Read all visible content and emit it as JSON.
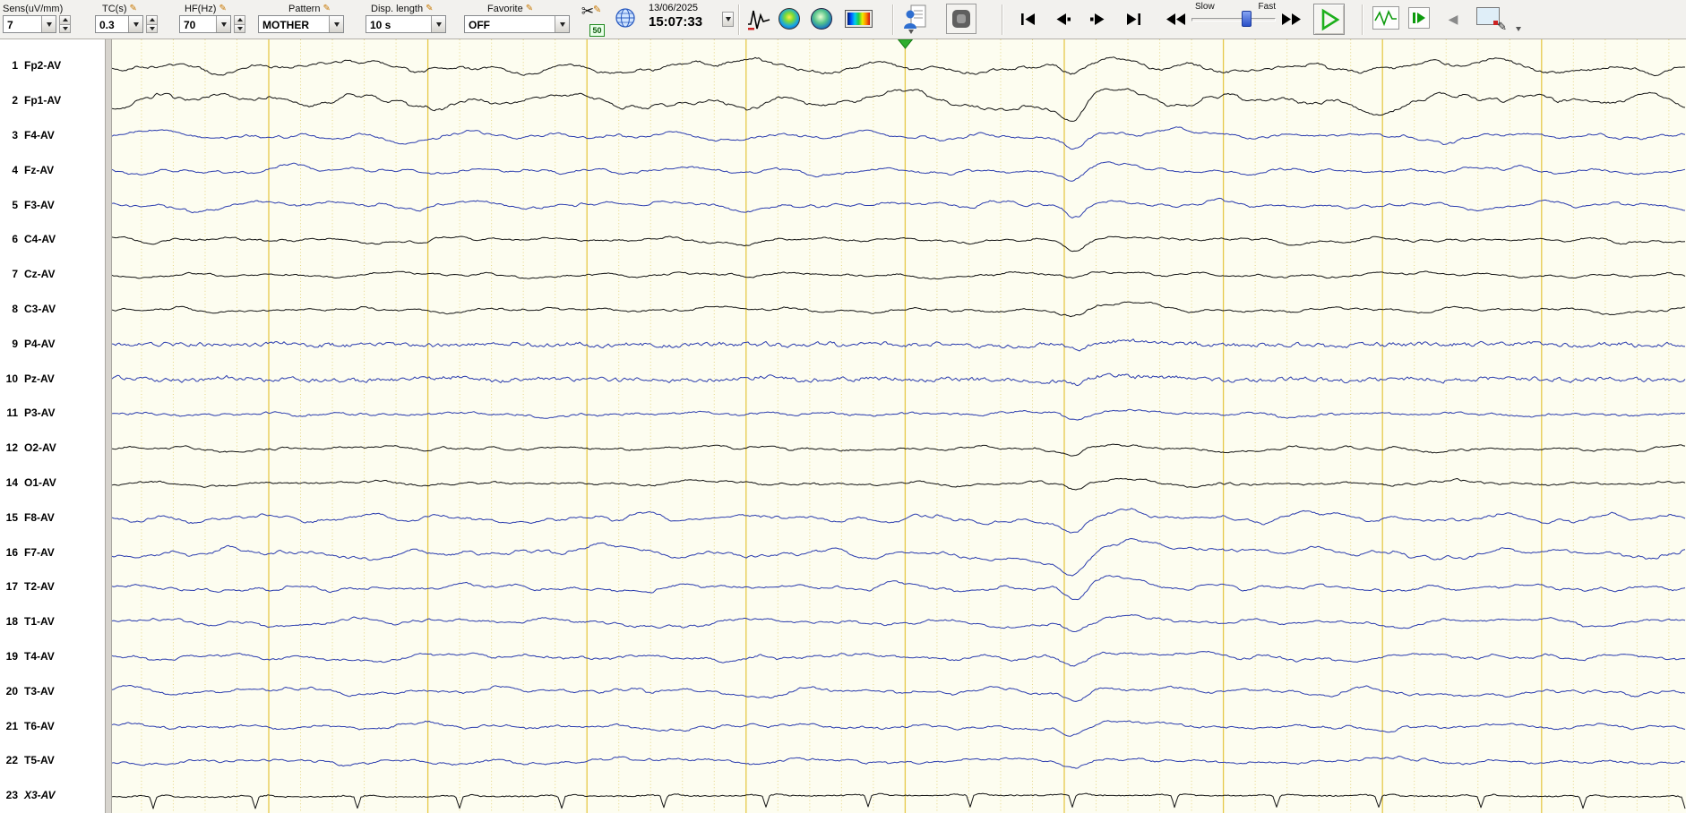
{
  "toolbar": {
    "sens": {
      "label": "Sens(uV/mm)",
      "value": "7"
    },
    "tc": {
      "label": "TC(s)",
      "value": "0.3"
    },
    "hf": {
      "label": "HF(Hz)",
      "value": "70"
    },
    "pattern": {
      "label": "Pattern",
      "value": "MOTHER"
    },
    "disp_length": {
      "label": "Disp. length",
      "value": "10 s"
    },
    "favorite": {
      "label": "Favorite",
      "value": "OFF"
    },
    "notch_badge": "50",
    "datetime": {
      "date": "13/06/2025",
      "time": "15:07:33"
    },
    "speed": {
      "slow": "Slow",
      "fast": "Fast"
    }
  },
  "icons": {
    "pencil": "✎",
    "scissors": "✂",
    "back_arrow_gray": "◀"
  },
  "colors": {
    "bg": "#fdfdf0",
    "trace_black": "#141414",
    "trace_blue": "#2b3cae",
    "grid_major": "#e6c94a",
    "grid_minor": "#e5d584",
    "marker_green": "#2eae2e"
  },
  "channels": [
    {
      "num": "1",
      "label": "Fp2-AV",
      "color": "black",
      "amp": 8.5,
      "fuzz": 1.2,
      "ev": 12,
      "slow": 1.5
    },
    {
      "num": "2",
      "label": "Fp1-AV",
      "color": "black",
      "amp": 9.5,
      "fuzz": 1.2,
      "ev": 20,
      "slow": 1.6
    },
    {
      "num": "3",
      "label": "F4-AV",
      "color": "blue",
      "amp": 7,
      "fuzz": 0.9,
      "ev": 15,
      "slow": 1.2
    },
    {
      "num": "4",
      "label": "Fz-AV",
      "color": "blue",
      "amp": 7,
      "fuzz": 0.9,
      "ev": 13,
      "slow": 1.1
    },
    {
      "num": "5",
      "label": "F3-AV",
      "color": "blue",
      "amp": 7.5,
      "fuzz": 0.9,
      "ev": 16,
      "slow": 1.2
    },
    {
      "num": "6",
      "label": "C4-AV",
      "color": "black",
      "amp": 5,
      "fuzz": 0.8,
      "ev": 9,
      "slow": 1
    },
    {
      "num": "7",
      "label": "Cz-AV",
      "color": "black",
      "amp": 4.5,
      "fuzz": 0.8,
      "ev": 7,
      "slow": 1
    },
    {
      "num": "8",
      "label": "C3-AV",
      "color": "black",
      "amp": 5.5,
      "fuzz": 0.8,
      "ev": 9,
      "slow": 1
    },
    {
      "num": "9",
      "label": "P4-AV",
      "color": "blue",
      "amp": 3.2,
      "fuzz": 2.2,
      "ev": 6,
      "slow": 0.8
    },
    {
      "num": "10",
      "label": "Pz-AV",
      "color": "blue",
      "amp": 3.2,
      "fuzz": 2.2,
      "ev": 8,
      "slow": 0.8
    },
    {
      "num": "11",
      "label": "P3-AV",
      "color": "blue",
      "amp": 4,
      "fuzz": 1,
      "ev": 8,
      "slow": 0.9
    },
    {
      "num": "12",
      "label": "O2-AV",
      "color": "black",
      "amp": 4.5,
      "fuzz": 0.9,
      "ev": 8,
      "slow": 1
    },
    {
      "num": "14",
      "label": "O1-AV",
      "color": "black",
      "amp": 4,
      "fuzz": 0.9,
      "ev": 7,
      "slow": 1
    },
    {
      "num": "15",
      "label": "F8-AV",
      "color": "blue",
      "amp": 7.5,
      "fuzz": 1,
      "ev": 17,
      "slow": 1.3
    },
    {
      "num": "16",
      "label": "F7-AV",
      "color": "blue",
      "amp": 8.5,
      "fuzz": 1,
      "ev": 24,
      "slow": 1.4
    },
    {
      "num": "17",
      "label": "T2-AV",
      "color": "blue",
      "amp": 6.5,
      "fuzz": 1,
      "ev": 15,
      "slow": 1.1
    },
    {
      "num": "18",
      "label": "T1-AV",
      "color": "blue",
      "amp": 6.5,
      "fuzz": 1,
      "ev": 13,
      "slow": 1.1
    },
    {
      "num": "19",
      "label": "T4-AV",
      "color": "blue",
      "amp": 6.5,
      "fuzz": 1,
      "ev": 11,
      "slow": 1.1
    },
    {
      "num": "20",
      "label": "T3-AV",
      "color": "blue",
      "amp": 6.5,
      "fuzz": 1,
      "ev": 13,
      "slow": 1.1
    },
    {
      "num": "21",
      "label": "T6-AV",
      "color": "blue",
      "amp": 5.5,
      "fuzz": 1,
      "ev": 9,
      "slow": 1
    },
    {
      "num": "22",
      "label": "T5-AV",
      "color": "blue",
      "amp": 5.5,
      "fuzz": 1,
      "ev": 8,
      "slow": 1
    },
    {
      "num": "23",
      "label": "X3-AV",
      "color": "black",
      "type": "ecg",
      "italic": true,
      "amp": 1,
      "fuzz": 0.6,
      "ev": 0,
      "slow": 0
    }
  ]
}
